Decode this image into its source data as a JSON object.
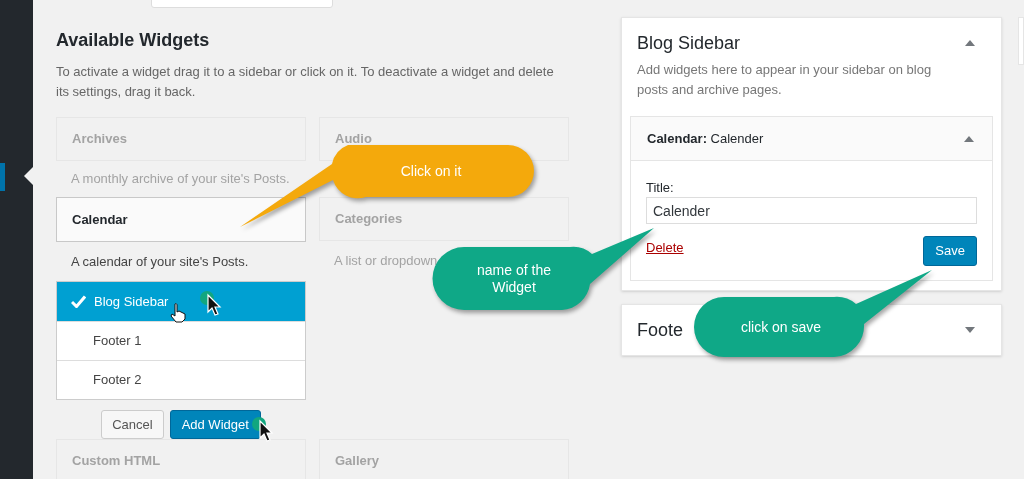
{
  "available_widgets": {
    "title": "Available Widgets",
    "description": "To activate a widget drag it to a sidebar or click on it. To deactivate a widget and delete its settings, drag it back.",
    "columns": [
      [
        {
          "name": "Archives",
          "description": "A monthly archive of your site's Posts.",
          "selected": false
        },
        {
          "name": "Calendar",
          "description": "A calendar of your site's Posts.",
          "selected": true,
          "chooser": {
            "sidebars": [
              {
                "label": "Blog Sidebar",
                "selected": true
              },
              {
                "label": "Footer 1",
                "selected": false
              },
              {
                "label": "Footer 2",
                "selected": false
              }
            ],
            "buttons": [
              {
                "label": "Cancel",
                "kind": "secondary"
              },
              {
                "label": "Add Widget",
                "kind": "primary"
              }
            ]
          }
        },
        {
          "name": "Custom HTML",
          "selected": false
        }
      ],
      [
        {
          "name": "Audio",
          "selected": false
        },
        {
          "name": "Categories",
          "description": "A list or dropdown",
          "selected": false
        },
        {
          "name": "Gallery",
          "selected": false
        }
      ]
    ]
  },
  "sidebars": [
    {
      "title": "Blog Sidebar",
      "expanded": true,
      "description": "Add widgets here to appear in your sidebar on blog posts and archive pages.",
      "widget": {
        "title": "**Calendar:** Calender",
        "expanded": true,
        "field_label": "Title:",
        "field_value": "Calender",
        "delete_link": "Delete",
        "save_button": "Save"
      }
    },
    {
      "title": "Foote",
      "expanded": false
    }
  ],
  "callouts": [
    {
      "text": "Click on it",
      "color": "#f4a90c"
    },
    {
      "text": "name of the Widget",
      "color": "#0fa887"
    },
    {
      "text": "click on save",
      "color": "#0fa887"
    }
  ]
}
